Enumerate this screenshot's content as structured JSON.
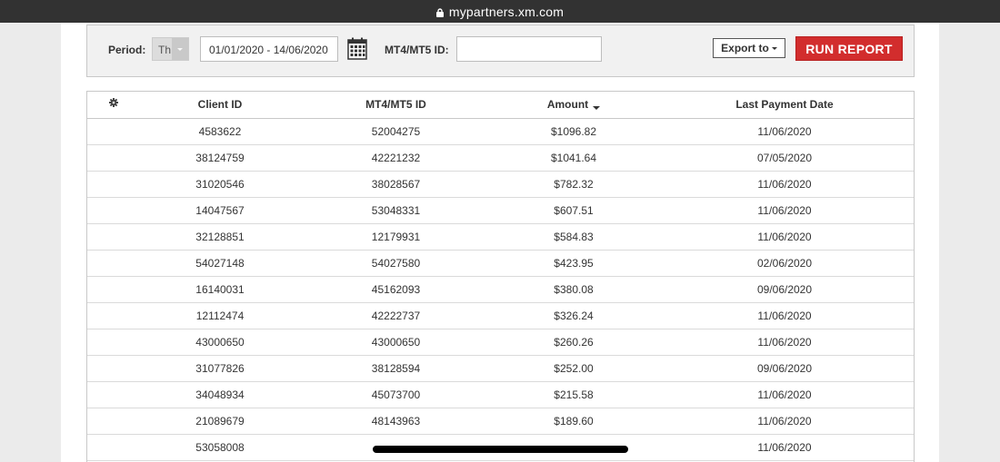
{
  "browser": {
    "url": "mypartners.xm.com",
    "lock_icon": "lock-icon"
  },
  "filters": {
    "period_label": "Period:",
    "period_value": "Th",
    "date_range": "01/01/2020 - 14/06/2020",
    "calendar_icon": "calendar-icon",
    "mt_label": "MT4/MT5 ID:",
    "mt_value": "",
    "export_label": "Export to",
    "run_label": "RUN REPORT"
  },
  "colors": {
    "run_button": "#d22d2d",
    "url_bar": "#323232"
  },
  "table": {
    "settings_icon": "gear-icon",
    "headers": [
      "Client ID",
      "MT4/MT5 ID",
      "Amount",
      "Last Payment Date"
    ],
    "sort": {
      "column": "Amount",
      "direction": "desc"
    },
    "rows": [
      [
        "4583622",
        "52004275",
        "$1096.82",
        "11/06/2020"
      ],
      [
        "38124759",
        "42221232",
        "$1041.64",
        "07/05/2020"
      ],
      [
        "31020546",
        "38028567",
        "$782.32",
        "11/06/2020"
      ],
      [
        "14047567",
        "53048331",
        "$607.51",
        "11/06/2020"
      ],
      [
        "32128851",
        "12179931",
        "$584.83",
        "11/06/2020"
      ],
      [
        "54027148",
        "54027580",
        "$423.95",
        "02/06/2020"
      ],
      [
        "16140031",
        "45162093",
        "$380.08",
        "09/06/2020"
      ],
      [
        "12112474",
        "42222737",
        "$326.24",
        "11/06/2020"
      ],
      [
        "43000650",
        "43000650",
        "$260.26",
        "11/06/2020"
      ],
      [
        "31077826",
        "38128594",
        "$252.00",
        "09/06/2020"
      ],
      [
        "34048934",
        "45073700",
        "$215.58",
        "11/06/2020"
      ],
      [
        "21089679",
        "48143963",
        "$189.60",
        "11/06/2020"
      ],
      [
        "53058008",
        "",
        "",
        "11/06/2020"
      ]
    ]
  }
}
